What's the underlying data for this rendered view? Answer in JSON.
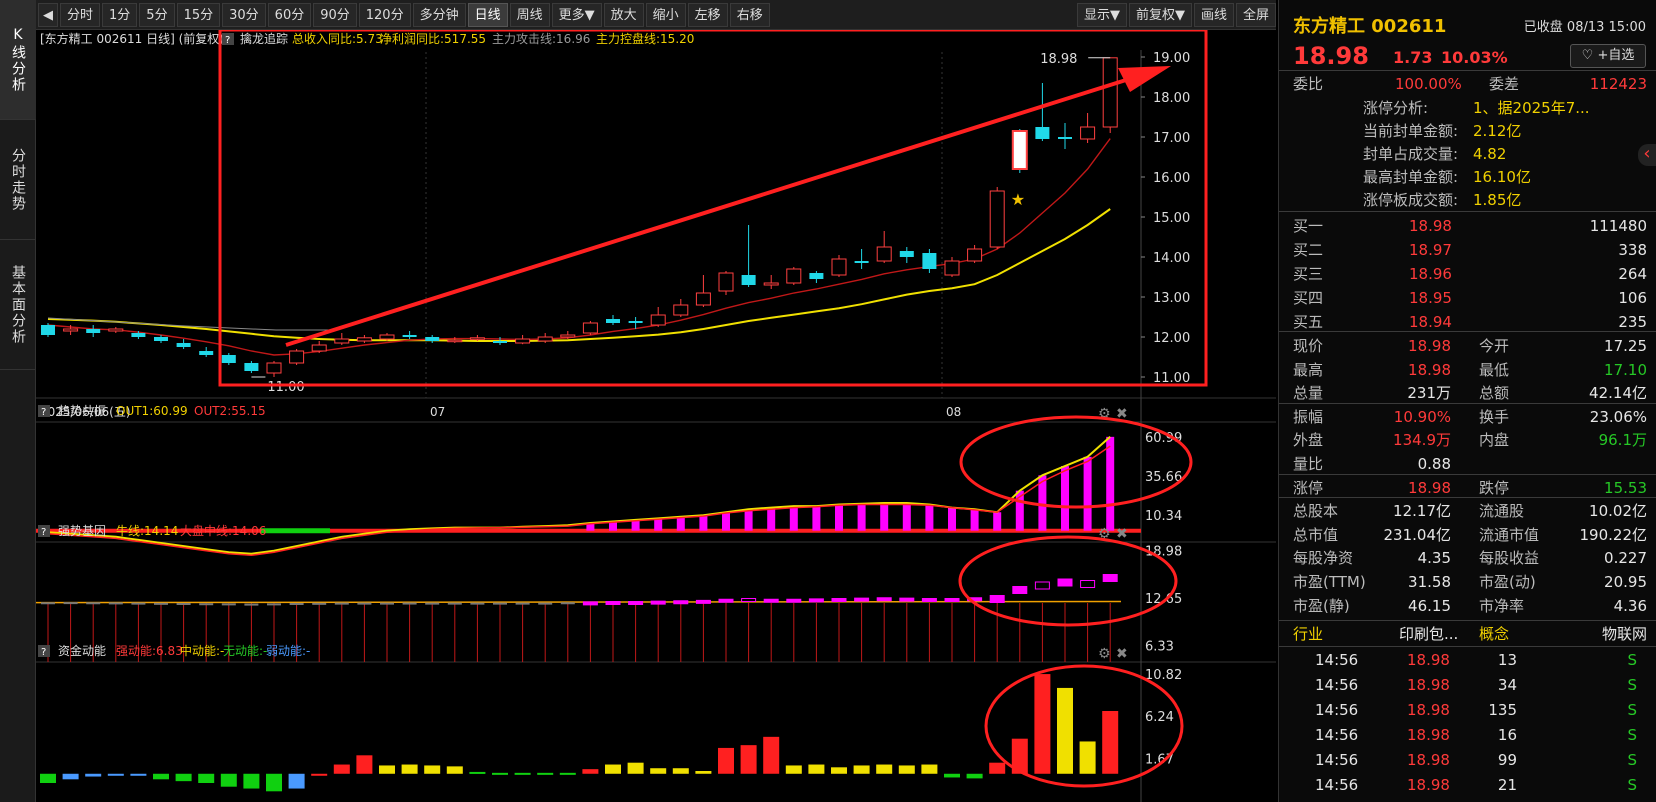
{
  "left_tabs": [
    "K线分析",
    "分时走势",
    "基本面分析"
  ],
  "toolbar": {
    "left": [
      "分时",
      "1分",
      "5分",
      "15分",
      "30分",
      "60分",
      "90分",
      "120分",
      "多分钟",
      "日线",
      "周线",
      "更多▼",
      "放大",
      "缩小",
      "左移",
      "右移"
    ],
    "active": "日线",
    "right": [
      "显示▼",
      "前复权▼",
      "画线",
      "全屏"
    ]
  },
  "main_panel": {
    "header_title": "[东方精工 002611 日线]  (前复权)",
    "indicator_name": "擒龙追踪",
    "ind_items": [
      {
        "text": "总收入同比:5.73",
        "color": "#f0d000"
      },
      {
        "text": "净利润同比:517.55",
        "color": "#f0d000"
      },
      {
        "text": "主力攻击线:16.96",
        "color": "#999999"
      },
      {
        "text": "主力控盘线:15.20",
        "color": "#f0d000"
      }
    ],
    "y_labels": [
      "19.00",
      "18.00",
      "17.00",
      "16.00",
      "15.00",
      "14.00",
      "13.00",
      "12.00",
      "11.00"
    ],
    "high_label": "18.98",
    "low_label": "11.00",
    "date_label": "2025/06/06(五)",
    "x_labels": [
      "07",
      "08"
    ]
  },
  "panel2": {
    "name": "趋势共振",
    "items": [
      {
        "text": "OUT1:60.99",
        "color": "#f0d000"
      },
      {
        "text": "OUT2:55.15",
        "color": "#ff3a3a"
      }
    ],
    "y_labels": [
      "60.99",
      "35.66",
      "10.34"
    ]
  },
  "panel3": {
    "name": "强势基因",
    "items": [
      {
        "text": "牛线:14.14",
        "color": "#f0d000"
      },
      {
        "text": "大盘中线:14.06",
        "color": "#ff3a3a"
      }
    ],
    "y_labels": [
      "18.98",
      "12.65",
      "6.33"
    ]
  },
  "panel4": {
    "name": "资金动能",
    "items": [
      {
        "text": "强动能:6.83",
        "color": "#ff3a3a"
      },
      {
        "text": "中动能:-",
        "color": "#f0d000"
      },
      {
        "text": "无动能:-",
        "color": "#26c826"
      },
      {
        "text": "弱动能:-",
        "color": "#4a9aff"
      }
    ],
    "y_labels": [
      "10.82",
      "6.24",
      "1.67"
    ]
  },
  "chart_data": {
    "type": "candlestick",
    "title": "东方精工 002611 日线",
    "ylim": [
      10.6,
      19.4
    ],
    "candles": [
      [
        12.3,
        12.05,
        12.35,
        12.0
      ],
      [
        12.15,
        12.2,
        12.3,
        12.05
      ],
      [
        12.2,
        12.1,
        12.3,
        12.0
      ],
      [
        12.15,
        12.2,
        12.25,
        12.1
      ],
      [
        12.1,
        12.0,
        12.15,
        11.95
      ],
      [
        12.0,
        11.9,
        12.05,
        11.85
      ],
      [
        11.85,
        11.75,
        11.95,
        11.7
      ],
      [
        11.65,
        11.55,
        11.75,
        11.5
      ],
      [
        11.55,
        11.35,
        11.6,
        11.3
      ],
      [
        11.35,
        11.15,
        11.4,
        11.1
      ],
      [
        11.1,
        11.35,
        11.4,
        11.0
      ],
      [
        11.35,
        11.65,
        11.7,
        11.3
      ],
      [
        11.65,
        11.8,
        11.9,
        11.6
      ],
      [
        11.85,
        11.95,
        12.1,
        11.8
      ],
      [
        11.9,
        11.98,
        12.05,
        11.85
      ],
      [
        11.95,
        12.05,
        12.1,
        11.9
      ],
      [
        12.05,
        12.0,
        12.15,
        11.95
      ],
      [
        12.0,
        11.9,
        12.05,
        11.85
      ],
      [
        11.9,
        11.92,
        12.0,
        11.85
      ],
      [
        11.95,
        11.98,
        12.05,
        11.9
      ],
      [
        11.9,
        11.85,
        12.0,
        11.8
      ],
      [
        11.85,
        11.95,
        12.05,
        11.82
      ],
      [
        11.9,
        12.0,
        12.1,
        11.85
      ],
      [
        12.0,
        12.05,
        12.15,
        11.95
      ],
      [
        12.1,
        12.35,
        12.4,
        12.05
      ],
      [
        12.45,
        12.35,
        12.55,
        12.3
      ],
      [
        12.4,
        12.35,
        12.5,
        12.2
      ],
      [
        12.3,
        12.55,
        12.75,
        12.25
      ],
      [
        12.55,
        12.8,
        12.95,
        12.5
      ],
      [
        12.8,
        13.1,
        13.55,
        12.75
      ],
      [
        13.15,
        13.6,
        13.65,
        13.05
      ],
      [
        13.55,
        13.3,
        14.8,
        13.25
      ],
      [
        13.3,
        13.35,
        13.55,
        13.2
      ],
      [
        13.35,
        13.7,
        13.75,
        13.3
      ],
      [
        13.6,
        13.45,
        13.65,
        13.35
      ],
      [
        13.55,
        13.95,
        14.05,
        13.5
      ],
      [
        13.9,
        13.85,
        14.2,
        13.7
      ],
      [
        13.9,
        14.25,
        14.65,
        13.85
      ],
      [
        14.15,
        14.0,
        14.25,
        13.85
      ],
      [
        14.1,
        13.7,
        14.2,
        13.6
      ],
      [
        13.55,
        13.9,
        14.0,
        13.5
      ],
      [
        13.9,
        14.2,
        14.3,
        13.85
      ],
      [
        14.25,
        15.65,
        15.75,
        14.2
      ],
      [
        17.15,
        16.2,
        17.2,
        16.1
      ],
      [
        17.25,
        16.95,
        18.35,
        16.9
      ],
      [
        17.0,
        16.95,
        17.35,
        16.7
      ],
      [
        16.95,
        17.25,
        17.6,
        16.85
      ],
      [
        17.25,
        18.98,
        18.98,
        17.1
      ]
    ],
    "ma_fast": [
      12.3,
      12.25,
      12.2,
      12.18,
      12.12,
      12.05,
      11.97,
      11.88,
      11.78,
      11.65,
      11.55,
      11.58,
      11.64,
      11.72,
      11.8,
      11.86,
      11.92,
      11.95,
      11.96,
      11.96,
      11.95,
      11.94,
      11.95,
      11.98,
      12.05,
      12.14,
      12.21,
      12.3,
      12.42,
      12.56,
      12.72,
      12.86,
      12.97,
      13.1,
      13.2,
      13.32,
      13.44,
      13.58,
      13.68,
      13.76,
      13.84,
      13.95,
      14.2,
      14.6,
      15.1,
      15.6,
      16.2,
      16.96
    ],
    "ma_slow": [
      12.45,
      12.43,
      12.41,
      12.38,
      12.34,
      12.3,
      12.25,
      12.2,
      12.14,
      12.08,
      12.02,
      11.98,
      11.95,
      11.93,
      11.92,
      11.92,
      11.92,
      11.92,
      11.91,
      11.9,
      11.9,
      11.9,
      11.91,
      11.92,
      11.95,
      11.98,
      12.02,
      12.06,
      12.12,
      12.2,
      12.3,
      12.4,
      12.48,
      12.56,
      12.64,
      12.72,
      12.82,
      12.94,
      13.06,
      13.15,
      13.22,
      13.32,
      13.55,
      13.85,
      14.15,
      14.45,
      14.8,
      15.2
    ]
  },
  "right_panel": {
    "title": "东方精工 002611",
    "status": "已收盘 08/13 15:00",
    "price": "18.98",
    "change": "1.73",
    "pct": "10.03%",
    "fav": "♡ +自选",
    "weibi_label": "委比",
    "weibi": "100.00%",
    "weicha_label": "委差",
    "weicha": "112423",
    "limit_info": [
      {
        "label": "涨停分析:",
        "value": "1、据2025年7..."
      },
      {
        "label": "当前封单金额:",
        "value": "2.12亿"
      },
      {
        "label": "封单占成交量:",
        "value": "4.82"
      },
      {
        "label": "最高封单金额:",
        "value": "16.10亿"
      },
      {
        "label": "涨停板成交额:",
        "value": "1.85亿"
      }
    ],
    "bids": [
      {
        "label": "买一",
        "price": "18.98",
        "vol": "111480"
      },
      {
        "label": "买二",
        "price": "18.97",
        "vol": "338"
      },
      {
        "label": "买三",
        "price": "18.96",
        "vol": "264"
      },
      {
        "label": "买四",
        "price": "18.95",
        "vol": "106"
      },
      {
        "label": "买五",
        "price": "18.94",
        "vol": "235"
      }
    ],
    "stats": [
      {
        "l1": "现价",
        "v1": "18.98",
        "c1": "red",
        "l2": "今开",
        "v2": "17.25",
        "c2": "white"
      },
      {
        "l1": "最高",
        "v1": "18.98",
        "c1": "red",
        "l2": "最低",
        "v2": "17.10",
        "c2": "green"
      },
      {
        "l1": "总量",
        "v1": "231万",
        "c1": "white",
        "l2": "总额",
        "v2": "42.14亿",
        "c2": "white"
      },
      {
        "l1": "振幅",
        "v1": "10.90%",
        "c1": "red",
        "l2": "换手",
        "v2": "23.06%",
        "c2": "white"
      },
      {
        "l1": "外盘",
        "v1": "134.9万",
        "c1": "red",
        "l2": "内盘",
        "v2": "96.1万",
        "c2": "green"
      },
      {
        "l1": "量比",
        "v1": "0.88",
        "c1": "white",
        "l2": "",
        "v2": "",
        "c2": "white"
      },
      {
        "l1": "涨停",
        "v1": "18.98",
        "c1": "red",
        "l2": "跌停",
        "v2": "15.53",
        "c2": "green"
      },
      {
        "l1": "总股本",
        "v1": "12.17亿",
        "c1": "white",
        "l2": "流通股",
        "v2": "10.02亿",
        "c2": "white"
      },
      {
        "l1": "总市值",
        "v1": "231.04亿",
        "c1": "white",
        "l2": "流通市值",
        "v2": "190.22亿",
        "c2": "white"
      },
      {
        "l1": "每股净资",
        "v1": "4.35",
        "c1": "white",
        "l2": "每股收益",
        "v2": "0.227",
        "c2": "white"
      },
      {
        "l1": "市盈(TTM)",
        "v1": "31.58",
        "c1": "white",
        "l2": "市盈(动)",
        "v2": "20.95",
        "c2": "white"
      },
      {
        "l1": "市盈(静)",
        "v1": "46.15",
        "c1": "white",
        "l2": "市净率",
        "v2": "4.36",
        "c2": "white"
      }
    ],
    "industry": {
      "l1": "行业",
      "v1": "印刷包...",
      "l2": "概念",
      "v2": "物联网"
    },
    "trades": [
      {
        "time": "14:56",
        "price": "18.98",
        "vol": "13",
        "flag": "S"
      },
      {
        "time": "14:56",
        "price": "18.98",
        "vol": "34",
        "flag": "S"
      },
      {
        "time": "14:56",
        "price": "18.98",
        "vol": "135",
        "flag": "S"
      },
      {
        "time": "14:56",
        "price": "18.98",
        "vol": "16",
        "flag": "S"
      },
      {
        "time": "14:56",
        "price": "18.98",
        "vol": "99",
        "flag": "S"
      },
      {
        "time": "14:56",
        "price": "18.98",
        "vol": "21",
        "flag": "S"
      }
    ]
  }
}
